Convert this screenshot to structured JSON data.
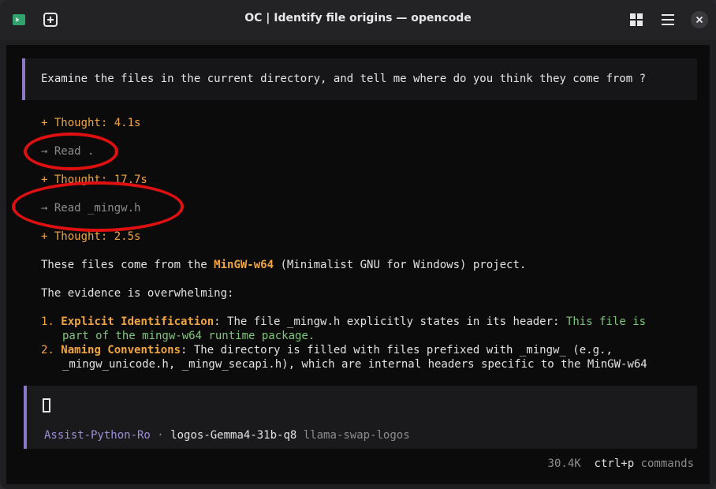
{
  "window": {
    "title": "OC | Identify file origins — opencode"
  },
  "icons": {
    "app": "terminal-app-icon",
    "new_tab": "new-tab-icon",
    "grid": "grid-view-icon",
    "menu": "hamburger-menu-icon",
    "close": "close-icon"
  },
  "conversation": {
    "user_prompt": "Examine the files in the current directory, and tell me where do you think they come from ?",
    "steps": [
      {
        "text": "+ Thought: 4.1s"
      },
      {
        "text": "→ Read ."
      },
      {
        "text": "+ Thought: 17.7s"
      },
      {
        "text": "→ Read _mingw.h"
      },
      {
        "text": "+ Thought: 2.5s"
      }
    ],
    "answer": {
      "p1_before": "These files come from the ",
      "p1_highlight": "MinGW-w64",
      "p1_after": " (Minimalist GNU for Windows) project.",
      "p2": "The evidence is overwhelming:",
      "item1_num": "1.",
      "item1_title": "Explicit Identification",
      "item1_text": ": The file _mingw.h explicitly states in its header: ",
      "item1_quote_a": "This file is",
      "item1_quote_b": "part of the mingw-w64 runtime package.",
      "item2_num": "2.",
      "item2_title": "Naming Conventions",
      "item2_text_a": ": The directory is filled with files prefixed with _mingw_ (e.g.,",
      "item2_text_b": "_mingw_unicode.h, _mingw_secapi.h), which are internal headers specific to the MinGW-w64"
    }
  },
  "input": {
    "agent": "Assist-Python-Ro",
    "separator": "·",
    "model": "logos-Gemma4-31b-q8",
    "provider": "llama-swap-logos"
  },
  "status": {
    "tokens": "30.4K",
    "shortcut": "ctrl+p",
    "shortcut_label": "commands"
  },
  "colors": {
    "accent": "#8b79c8",
    "orange": "#f0a540",
    "green": "#7fc77a",
    "annotation": "#e01010"
  }
}
